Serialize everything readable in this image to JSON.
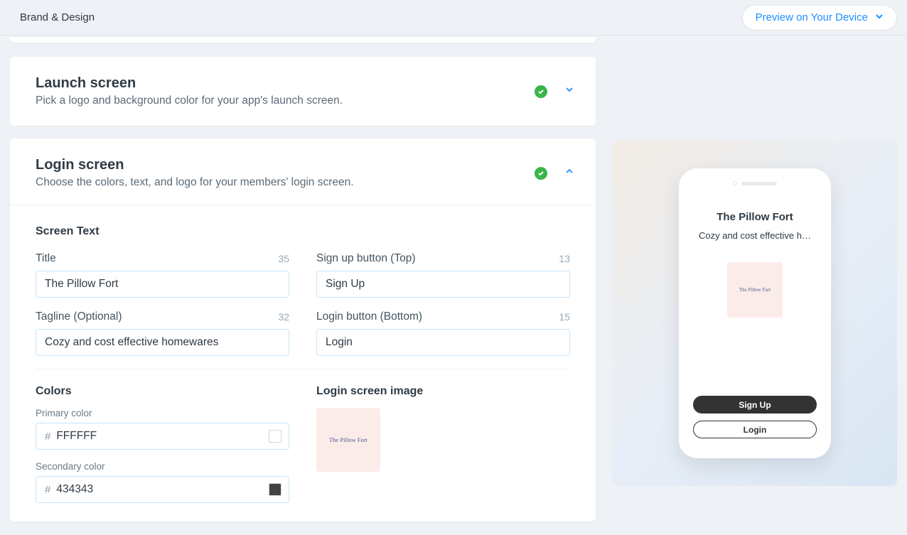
{
  "header": {
    "title": "Brand & Design",
    "preview_label": "Preview on Your Device"
  },
  "launch_section": {
    "title": "Launch screen",
    "description": "Pick a logo and background color for your app's launch screen."
  },
  "login_section": {
    "title": "Login screen",
    "description": "Choose the colors, text, and logo for your members' login screen."
  },
  "screen_text": {
    "heading": "Screen Text",
    "title_label": "Title",
    "title_count": "35",
    "title_value": "The Pillow Fort",
    "signup_label": "Sign up button (Top)",
    "signup_count": "13",
    "signup_value": "Sign Up",
    "tagline_label": "Tagline (Optional)",
    "tagline_count": "32",
    "tagline_value": "Cozy and cost effective homewares",
    "loginbtn_label": "Login button (Bottom)",
    "loginbtn_count": "15",
    "loginbtn_value": "Login"
  },
  "colors": {
    "heading": "Colors",
    "primary_label": "Primary color",
    "primary_value": "FFFFFF",
    "primary_swatch": "#FFFFFF",
    "secondary_label": "Secondary color",
    "secondary_value": "434343",
    "secondary_swatch": "#434343",
    "hash": "#"
  },
  "login_image": {
    "heading": "Login screen image",
    "logo_text": "The Pillow Fort"
  },
  "phone": {
    "title": "The Pillow Fort",
    "tagline": "Cozy and cost effective h…",
    "logo_text": "The Pillow Fort",
    "signup": "Sign Up",
    "login": "Login"
  }
}
